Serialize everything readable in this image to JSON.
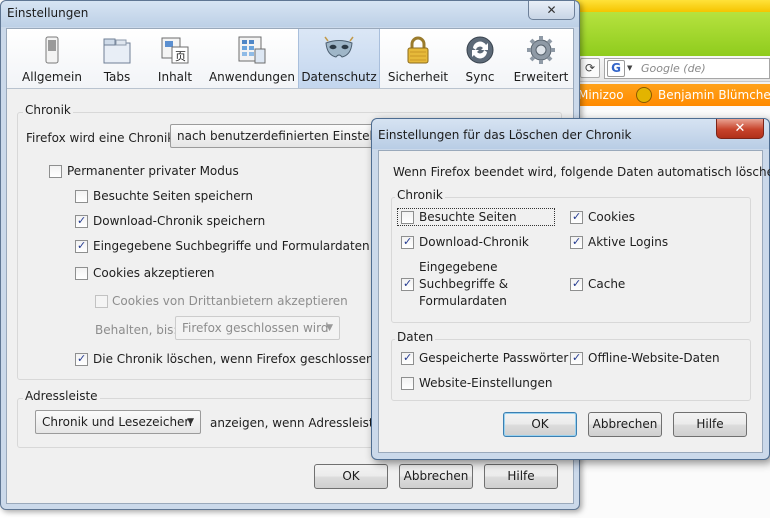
{
  "background_browser": {
    "search_placeholder": "Google (de)",
    "search_engine_glyph": "G",
    "bookmarks": [
      "Minizoo",
      "Benjamin Blümchen"
    ]
  },
  "main_dialog": {
    "title": "Einstellungen",
    "close_glyph": "✕",
    "panes": [
      {
        "id": "allgemein",
        "label": "Allgemein",
        "icon": "switch-icon",
        "selected": false
      },
      {
        "id": "tabs",
        "label": "Tabs",
        "icon": "tabs-icon",
        "selected": false
      },
      {
        "id": "inhalt",
        "label": "Inhalt",
        "icon": "content-icon",
        "selected": false
      },
      {
        "id": "anwendungen",
        "label": "Anwendungen",
        "icon": "applications-icon",
        "selected": false
      },
      {
        "id": "datenschutz",
        "label": "Datenschutz",
        "icon": "mask-icon",
        "selected": true
      },
      {
        "id": "sicherheit",
        "label": "Sicherheit",
        "icon": "padlock-icon",
        "selected": false
      },
      {
        "id": "sync",
        "label": "Sync",
        "icon": "sync-icon",
        "selected": false
      },
      {
        "id": "erweitert",
        "label": "Erweitert",
        "icon": "gear-icon",
        "selected": false
      }
    ],
    "history": {
      "group_label": "Chronik",
      "mode_label": "Firefox wird eine Chronik:",
      "mode_value": "nach benutzerdefinierten Einstellungen anlegen",
      "private_mode": {
        "label": "Permanenter privater Modus",
        "checked": false
      },
      "remember_visits": {
        "label": "Besuchte Seiten speichern",
        "checked": false
      },
      "remember_downloads": {
        "label": "Download-Chronik speichern",
        "checked": true
      },
      "remember_forms": {
        "label": "Eingegebene Suchbegriffe und Formulardaten speichern",
        "checked": true
      },
      "accept_cookies": {
        "label": "Cookies akzeptieren",
        "checked": false
      },
      "third_party_cookies": {
        "label": "Cookies von Drittanbietern akzeptieren",
        "checked": false
      },
      "keep_until_label": "Behalten, bis:",
      "keep_until_value": "Firefox geschlossen wird",
      "clear_on_close": {
        "label": "Die Chronik löschen, wenn Firefox geschlossen wird",
        "checked": true
      }
    },
    "location_bar": {
      "group_label": "Adressleiste",
      "suggest_value": "Chronik und Lesezeichen",
      "suggest_suffix": "anzeigen, wenn Adressleiste verwendet wird"
    },
    "buttons": {
      "ok": "OK",
      "cancel": "Abbrechen",
      "help": "Hilfe"
    }
  },
  "clear_dialog": {
    "title": "Einstellungen für das Löschen der Chronik",
    "close_glyph": "✕",
    "intro": "Wenn Firefox beendet wird, folgende Daten automatisch löschen:",
    "history_group": "Chronik",
    "history_items": {
      "visited": {
        "label": "Besuchte Seiten",
        "checked": false
      },
      "downloads": {
        "label": "Download-Chronik",
        "checked": true
      },
      "forms": {
        "label_lines": [
          "Eingegebene",
          "Suchbegriffe &",
          "Formulardaten"
        ],
        "checked": true
      },
      "cookies": {
        "label": "Cookies",
        "checked": true
      },
      "logins": {
        "label": "Aktive Logins",
        "checked": true
      },
      "cache": {
        "label": "Cache",
        "checked": true
      }
    },
    "data_group": "Daten",
    "data_items": {
      "passwords": {
        "label": "Gespeicherte Passwörter",
        "checked": true
      },
      "site_settings": {
        "label": "Website-Einstellungen",
        "checked": false
      },
      "offline_data": {
        "label": "Offline-Website-Daten",
        "checked": true
      }
    },
    "buttons": {
      "ok": "OK",
      "cancel": "Abbrechen",
      "help": "Hilfe"
    }
  },
  "check_glyph": "✓"
}
